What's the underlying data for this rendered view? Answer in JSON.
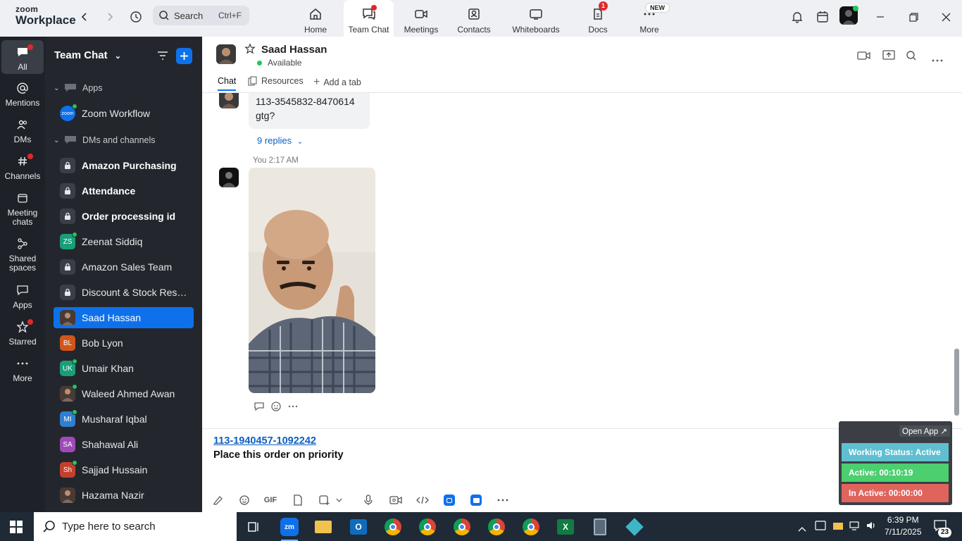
{
  "app": {
    "logo_line1": "zoom",
    "logo_line2": "Workplace"
  },
  "search": {
    "label": "Search",
    "shortcut": "Ctrl+F"
  },
  "top_tabs": [
    {
      "label": "Home",
      "icon": "home-icon"
    },
    {
      "label": "Team Chat",
      "icon": "chat-icon",
      "dot": true
    },
    {
      "label": "Meetings",
      "icon": "video-icon"
    },
    {
      "label": "Contacts",
      "icon": "contacts-icon"
    },
    {
      "label": "Whiteboards",
      "icon": "whiteboard-icon"
    },
    {
      "label": "Docs",
      "icon": "docs-icon",
      "badge": "1"
    },
    {
      "label": "More",
      "icon": "more-icon",
      "badge": "NEW"
    }
  ],
  "rail": [
    {
      "label": "All",
      "icon": "chat-bubble-icon"
    },
    {
      "label": "Mentions",
      "icon": "at-icon"
    },
    {
      "label": "DMs",
      "icon": "people-icon"
    },
    {
      "label": "Channels",
      "icon": "hash-icon"
    },
    {
      "label": "Meeting chats",
      "icon": "calendar-icon"
    },
    {
      "label": "Shared spaces",
      "icon": "shared-icon"
    },
    {
      "label": "Apps",
      "icon": "apps-icon"
    },
    {
      "label": "Starred",
      "icon": "star-icon"
    },
    {
      "label": "More",
      "icon": "ellipsis-icon"
    }
  ],
  "sidebar": {
    "title": "Team Chat",
    "apps_section": "Apps",
    "apps": [
      {
        "name": "Zoom Workflow",
        "avatar": "zoom"
      }
    ],
    "dms_section": "DMs and channels",
    "items": [
      {
        "name": "Amazon Purchasing",
        "avatar": "",
        "type": "channel",
        "bold": true
      },
      {
        "name": "Attendance",
        "avatar": "",
        "type": "channel",
        "bold": true
      },
      {
        "name": "Order processing id",
        "avatar": "",
        "type": "channel",
        "bold": true
      },
      {
        "name": "Zeenat Siddiq",
        "avatar": "ZS",
        "color": "#1a9e7a",
        "type": "dm",
        "online": true
      },
      {
        "name": "Amazon Sales Team",
        "avatar": "",
        "type": "channel"
      },
      {
        "name": "Discount & Stock Reser...",
        "avatar": "",
        "type": "channel"
      },
      {
        "name": "Saad Hassan",
        "avatar": "",
        "type": "dm-photo",
        "selected": true
      },
      {
        "name": "Bob Lyon",
        "avatar": "BL",
        "color": "#d2561c",
        "type": "dm"
      },
      {
        "name": "Umair Khan",
        "avatar": "UK",
        "color": "#1a9e7a",
        "type": "dm",
        "online": true
      },
      {
        "name": "Waleed Ahmed Awan",
        "avatar": "",
        "type": "dm-photo",
        "online": true
      },
      {
        "name": "Musharaf Iqbal",
        "avatar": "MI",
        "color": "#2f7fd1",
        "type": "dm",
        "online": true
      },
      {
        "name": "Shahawal Ali",
        "avatar": "SA",
        "color": "#a04ab8",
        "type": "dm"
      },
      {
        "name": "Sajjad Hussain",
        "avatar": "Sh",
        "color": "#c2402e",
        "type": "dm",
        "online": true
      },
      {
        "name": "Hazama Nazir",
        "avatar": "",
        "type": "dm-photo"
      }
    ]
  },
  "chat": {
    "contact_name": "Saad Hassan",
    "status": "Available",
    "tabs": [
      "Chat",
      "Resources",
      "Add a tab"
    ],
    "prev_message_lines": [
      "113-3545832-8470614",
      "gtg?"
    ],
    "replies": "9 replies",
    "sender_time": "You 2:17 AM"
  },
  "composer": {
    "link": "113-1940457-1092242",
    "text": "Place this order on priority",
    "gif_label": "GIF"
  },
  "widget": {
    "open_app": "Open App ↗",
    "working_status": "Working Status: Active",
    "active": "Active: 00:10:19",
    "inactive": "In Active: 00:00:00"
  },
  "taskbar": {
    "search_placeholder": "Type here to search",
    "time": "6:39 PM",
    "date": "7/11/2025",
    "notifications": "23"
  }
}
